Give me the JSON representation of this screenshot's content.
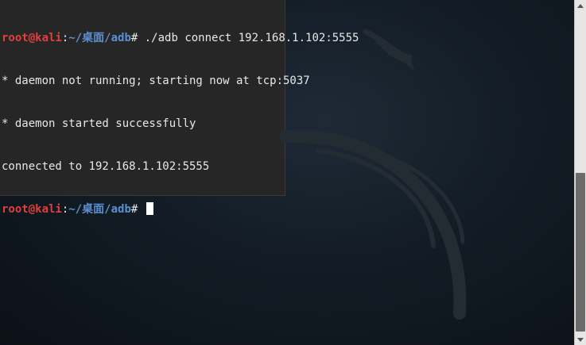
{
  "terminal": {
    "prompt": {
      "user": "root@kali",
      "sep": ":",
      "path": "~/桌面/adb",
      "symbol": "#"
    },
    "lines": [
      {
        "kind": "prompt",
        "command": " ./adb connect 192.168.1.102:5555"
      },
      {
        "kind": "output",
        "text": "* daemon not running; starting now at tcp:5037"
      },
      {
        "kind": "output",
        "text": "* daemon started successfully"
      },
      {
        "kind": "output",
        "text": "connected to 192.168.1.102:5555"
      },
      {
        "kind": "prompt",
        "command": " "
      }
    ]
  },
  "scrollbar": {
    "up_icon": "arrow-up-icon",
    "down_icon": "arrow-down-icon",
    "position": 0.5
  },
  "colors": {
    "user": "#e0403c",
    "path": "#5c8fd1",
    "text": "#e8e8e8",
    "panel": "#262626"
  }
}
